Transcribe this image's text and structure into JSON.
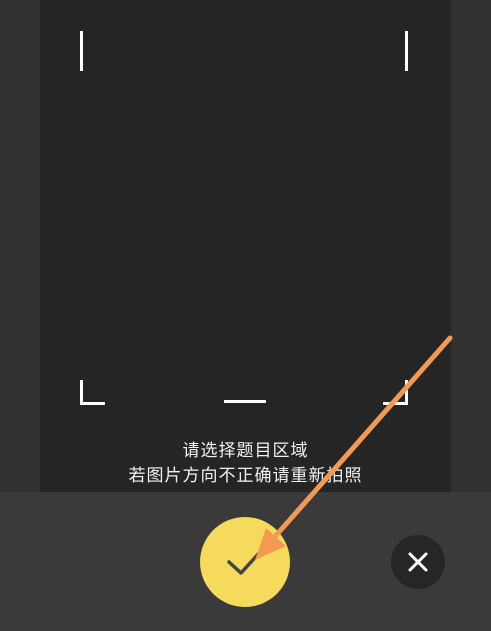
{
  "hint": {
    "line1": "请选择题目区域",
    "line2": "若图片方向不正确请重新拍照"
  },
  "actions": {
    "confirm_icon": "check-icon",
    "close_icon": "close-icon"
  },
  "colors": {
    "confirm": "#f6da5b",
    "close_bg": "#262626",
    "annotation_arrow": "#f39a52"
  }
}
